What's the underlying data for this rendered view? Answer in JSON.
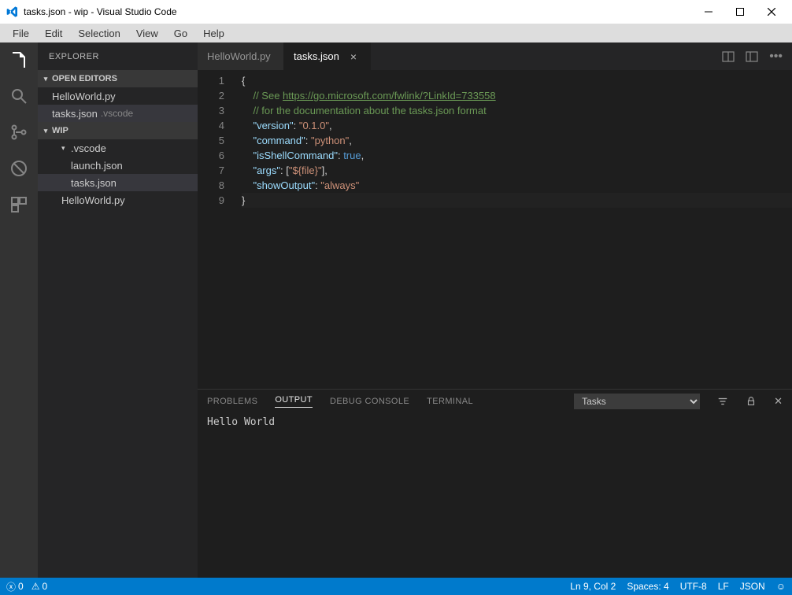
{
  "window": {
    "title": "tasks.json - wip - Visual Studio Code"
  },
  "menubar": [
    "File",
    "Edit",
    "Selection",
    "View",
    "Go",
    "Help"
  ],
  "sidebar": {
    "title": "EXPLORER",
    "sections": {
      "open_editors": {
        "label": "OPEN EDITORS",
        "items": [
          {
            "label": "HelloWorld.py"
          },
          {
            "label": "tasks.json",
            "desc": ".vscode",
            "selected": true
          }
        ]
      },
      "workspace": {
        "label": "WIP",
        "items": [
          {
            "label": ".vscode",
            "expandable": true,
            "expanded": true
          },
          {
            "label": "launch.json",
            "indent": 2
          },
          {
            "label": "tasks.json",
            "indent": 2,
            "selected": true
          },
          {
            "label": "HelloWorld.py",
            "indent": 1
          }
        ]
      }
    }
  },
  "tabs": [
    {
      "label": "HelloWorld.py",
      "active": false
    },
    {
      "label": "tasks.json",
      "active": true
    }
  ],
  "editor": {
    "lines": [
      {
        "n": 1,
        "type": "brace",
        "text": "{"
      },
      {
        "n": 2,
        "type": "cmt",
        "prefix": "// See ",
        "link": "https://go.microsoft.com/fwlink/?LinkId=733558"
      },
      {
        "n": 3,
        "type": "cmt",
        "text": "// for the documentation about the tasks.json format"
      },
      {
        "n": 4,
        "type": "kv",
        "key": "version",
        "valStr": "0.1.0",
        "comma": true
      },
      {
        "n": 5,
        "type": "kv",
        "key": "command",
        "valStr": "python",
        "comma": true
      },
      {
        "n": 6,
        "type": "kv",
        "key": "isShellCommand",
        "valKw": "true",
        "comma": true
      },
      {
        "n": 7,
        "type": "args",
        "key": "args",
        "item": "${file}",
        "comma": true
      },
      {
        "n": 8,
        "type": "kv",
        "key": "showOutput",
        "valStr": "always",
        "comma": false
      },
      {
        "n": 9,
        "type": "brace",
        "text": "}"
      }
    ]
  },
  "panel": {
    "tabs": [
      "PROBLEMS",
      "OUTPUT",
      "DEBUG CONSOLE",
      "TERMINAL"
    ],
    "active": "OUTPUT",
    "channel": "Tasks",
    "content": "Hello World"
  },
  "statusbar": {
    "errors": "0",
    "warnings": "0",
    "lncol": "Ln 9, Col 2",
    "spaces": "Spaces: 4",
    "encoding": "UTF-8",
    "eol": "LF",
    "language": "JSON"
  }
}
